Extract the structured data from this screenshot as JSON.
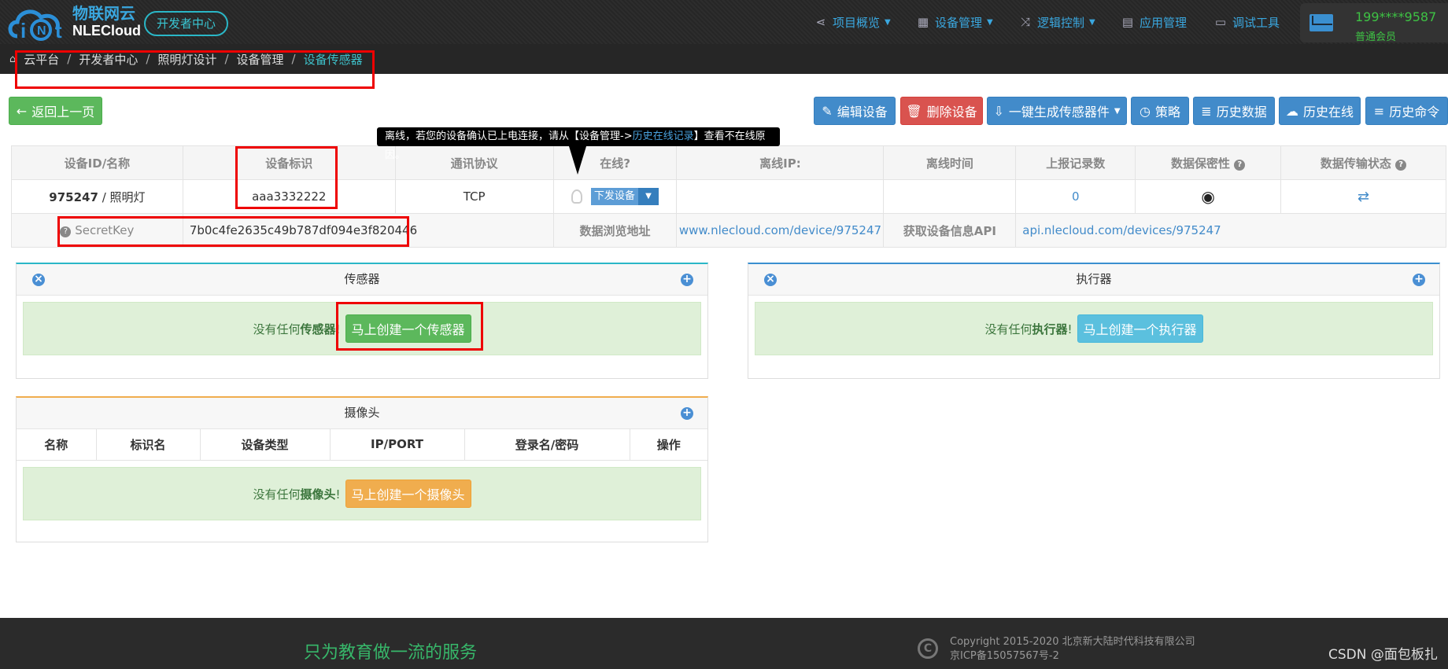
{
  "nav": {
    "brand_cn": "物联网云",
    "brand_en": "NLECloud",
    "dev_center": "开发者中心",
    "items": [
      {
        "label": "项目概览",
        "icon": "share-icon"
      },
      {
        "label": "设备管理",
        "icon": "grid-icon"
      },
      {
        "label": "逻辑控制",
        "icon": "shuffle-icon"
      },
      {
        "label": "应用管理",
        "icon": "app-icon"
      },
      {
        "label": "调试工具",
        "icon": "monitor-icon"
      }
    ],
    "user_phone": "199****9587",
    "user_level": "普通会员"
  },
  "breadcrumb": [
    "云平台",
    "开发者中心",
    "照明灯设计",
    "设备管理",
    "设备传感器"
  ],
  "toolbar": {
    "back": "返回上一页",
    "edit": "编辑设备",
    "delete": "删除设备",
    "generate": "一键生成传感器件",
    "strategy": "策略",
    "history_data": "历史数据",
    "history_online": "历史在线",
    "history_cmd": "历史命令"
  },
  "tooltip": {
    "pre": "离线，若您的设备确认已上电连接，请从【设备管理->",
    "link": "历史在线记录",
    "post": "】查看不在线原因。"
  },
  "device": {
    "headers": [
      "设备ID/名称",
      "设备标识",
      "通讯协议",
      "在线?",
      "离线IP:",
      "离线时间",
      "上报记录数",
      "数据保密性",
      "数据传输状态"
    ],
    "id": "975247",
    "name": "/ 照明灯",
    "tag": "aaa3332222",
    "protocol": "TCP",
    "send_label": "下发设备",
    "records": "0",
    "secret_label": "SecretKey",
    "secret_value": "7b0c4fe2635c49b787df094e3f820446",
    "browse_label": "数据浏览地址",
    "browse_url": "www.nlecloud.com/device/975247",
    "api_label": "获取设备信息API",
    "api_url": "api.nlecloud.com/devices/975247"
  },
  "sensor_panel": {
    "title": "传感器",
    "empty_pre": "没有任何",
    "empty_bold": "传感器",
    "empty_post": "!",
    "create": "马上创建一个传感器"
  },
  "actuator_panel": {
    "title": "执行器",
    "empty_pre": "没有任何",
    "empty_bold": "执行器",
    "empty_post": "!",
    "create": "马上创建一个执行器"
  },
  "camera_panel": {
    "title": "摄像头",
    "columns": [
      "名称",
      "标识名",
      "设备类型",
      "IP/PORT",
      "登录名/密码",
      "操作"
    ],
    "empty_pre": "没有任何",
    "empty_bold": "摄像头",
    "empty_post": "!",
    "create": "马上创建一个摄像头"
  },
  "footer": {
    "slogan": "只为教育做一流的服务",
    "copyright": "Copyright 2015-2020 北京新大陆时代科技有限公司",
    "icp": "京ICP备15057567号-2",
    "watermark": "CSDN @面包板扎"
  },
  "colors": {
    "accent_blue": "#428bca",
    "success_green": "#5cb85c",
    "danger_red": "#d9534f",
    "highlight_red": "#e00000"
  }
}
